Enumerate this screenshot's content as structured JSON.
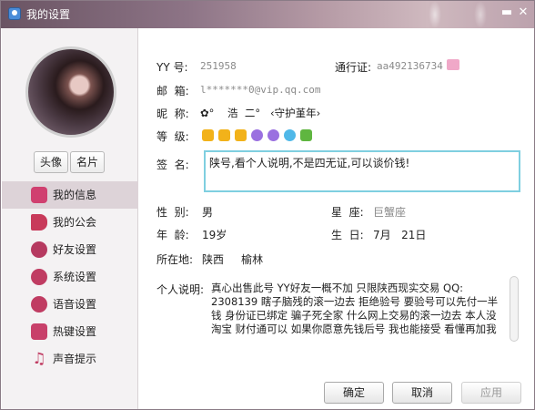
{
  "window": {
    "title": "我的设置",
    "controls": [
      "minimize",
      "close"
    ]
  },
  "sidebar": {
    "tabs": [
      {
        "label": "头像",
        "icon": "avatar"
      },
      {
        "label": "名片",
        "icon": "card"
      }
    ],
    "items": [
      {
        "label": "我的信息",
        "icon": "profile-card-icon",
        "active": true
      },
      {
        "label": "我的公会",
        "icon": "flag-icon",
        "active": false
      },
      {
        "label": "好友设置",
        "icon": "friends-icon",
        "active": false
      },
      {
        "label": "系统设置",
        "icon": "gear-icon",
        "active": false
      },
      {
        "label": "语音设置",
        "icon": "speaker-icon",
        "active": false
      },
      {
        "label": "热键设置",
        "icon": "keyboard-icon",
        "active": false
      },
      {
        "label": "声音提示",
        "icon": "music-note-icon",
        "active": false
      }
    ]
  },
  "profile": {
    "yy_label": "YY 号:",
    "yy_value": "251958",
    "pass_label": "通行证:",
    "pass_value": "aa492136734",
    "email_label": "邮  箱:",
    "email_value": "l*******0@vip.qq.com",
    "nickname_label": "昵  称:",
    "nickname_value": "✿°    浩  二°   ‹守护堇年›",
    "level_label": "等  级:",
    "sign_label": "签  名:",
    "sign_value": "陕号,看个人说明,不是四无证,可以谈价钱!",
    "gender_label": "性  别:",
    "gender_value": "男",
    "zodiac_label": "星  座:",
    "zodiac_value": "巨蟹座",
    "age_label": "年  龄:",
    "age_value": "19岁",
    "birthday_label": "生  日:",
    "birthday_value": "7月   21日",
    "location_label": "所在地:",
    "location_value": "陕西     榆林",
    "desc_label": "个人说明:",
    "desc_value": "真心出售此号 YY好友一概不加 只限陕西现实交易 QQ: 2308139  瞎子脑残的滚一边去  拒绝验号 要验号可以先付一半钱 身份证已绑定  骗子死全家 什么网上交易的滚一边去 本人没淘宝 财付通可以 如果你愿意先钱后号 我也能接受 看懂再加我"
  },
  "colors": {
    "accent": "#7fcfe0",
    "sidebar_active": "#ddd3d8",
    "title_gradient_start": "#6a5463"
  },
  "buttons": {
    "ok": "确定",
    "cancel": "取消",
    "apply": "应用"
  }
}
